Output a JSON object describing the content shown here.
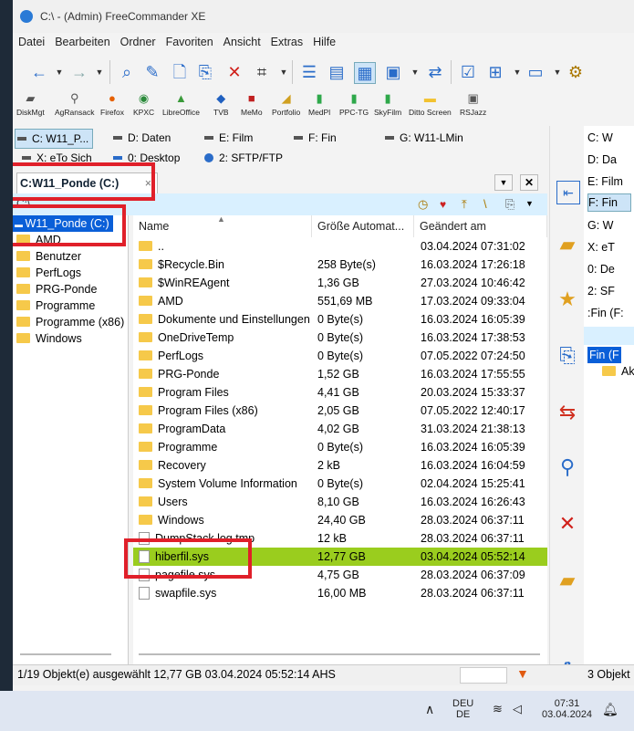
{
  "window": {
    "title": "C:\\ - (Admin) FreeCommander XE"
  },
  "menu": [
    "Datei",
    "Bearbeiten",
    "Ordner",
    "Favoriten",
    "Ansicht",
    "Extras",
    "Hilfe"
  ],
  "toolbar_apps": [
    {
      "label": "DiskMgt",
      "icon": "disk-icon"
    },
    {
      "label": "AgRansack",
      "icon": "search-tool-icon"
    },
    {
      "label": "Firefox",
      "icon": "firefox-icon"
    },
    {
      "label": "KPXC",
      "icon": "keepass-icon"
    },
    {
      "label": "LibreOffice",
      "icon": "libreoffice-icon"
    },
    {
      "label": "TVB",
      "icon": "tvb-icon"
    },
    {
      "label": "MeMo",
      "icon": "memo-icon"
    },
    {
      "label": "Portfolio",
      "icon": "portfolio-icon"
    },
    {
      "label": "MedPl",
      "icon": "medpl-icon"
    },
    {
      "label": "PPC-TG",
      "icon": "ppc-icon"
    },
    {
      "label": "SkyFilm",
      "icon": "skyfilm-icon"
    },
    {
      "label": "Ditto Screen",
      "icon": "folder-icon"
    },
    {
      "label": "RSJazz",
      "icon": "rsjazz-icon"
    }
  ],
  "drives_left": [
    {
      "label": "C: W11_P..."
    },
    {
      "label": "D: Daten"
    },
    {
      "label": "E: Film"
    },
    {
      "label": "F: Fin"
    },
    {
      "label": "G: W11-LMin"
    },
    {
      "label": "X: eTo Sich"
    },
    {
      "label": "0: Desktop"
    },
    {
      "label": "2: SFTP/FTP"
    }
  ],
  "left_tab": {
    "label": "C:W11_Ponde (C:)",
    "close": "×"
  },
  "path": "C:\\",
  "tree": {
    "root": "W11_Ponde (C:)",
    "items": [
      "AMD",
      "Benutzer",
      "PerfLogs",
      "PRG-Ponde",
      "Programme",
      "Programme (x86)",
      "Windows"
    ]
  },
  "columns": {
    "name": "Name",
    "size": "Größe Automat...",
    "date": "Geändert am"
  },
  "files": [
    {
      "name": "..",
      "size": "",
      "date": "03.04.2024 07:31:02",
      "type": "folder"
    },
    {
      "name": "$Recycle.Bin",
      "size": "258 Byte(s)",
      "date": "16.03.2024 17:26:18",
      "type": "folder"
    },
    {
      "name": "$WinREAgent",
      "size": "1,36 GB",
      "date": "27.03.2024 10:46:42",
      "type": "folder"
    },
    {
      "name": "AMD",
      "size": "551,69 MB",
      "date": "17.03.2024 09:33:04",
      "type": "folder"
    },
    {
      "name": "Dokumente und Einstellungen",
      "size": "0 Byte(s)",
      "date": "16.03.2024 16:05:39",
      "type": "folder"
    },
    {
      "name": "OneDriveTemp",
      "size": "0 Byte(s)",
      "date": "16.03.2024 17:38:53",
      "type": "folder"
    },
    {
      "name": "PerfLogs",
      "size": "0 Byte(s)",
      "date": "07.05.2022 07:24:50",
      "type": "folder"
    },
    {
      "name": "PRG-Ponde",
      "size": "1,52 GB",
      "date": "16.03.2024 17:55:55",
      "type": "folder"
    },
    {
      "name": "Program Files",
      "size": "4,41 GB",
      "date": "20.03.2024 15:33:37",
      "type": "folder"
    },
    {
      "name": "Program Files (x86)",
      "size": "2,05 GB",
      "date": "07.05.2022 12:40:17",
      "type": "folder"
    },
    {
      "name": "ProgramData",
      "size": "4,02 GB",
      "date": "31.03.2024 21:38:13",
      "type": "folder"
    },
    {
      "name": "Programme",
      "size": "0 Byte(s)",
      "date": "16.03.2024 16:05:39",
      "type": "folder"
    },
    {
      "name": "Recovery",
      "size": "2 kB",
      "date": "16.03.2024 16:04:59",
      "type": "folder"
    },
    {
      "name": "System Volume Information",
      "size": "0 Byte(s)",
      "date": "02.04.2024 15:25:41",
      "type": "folder"
    },
    {
      "name": "Users",
      "size": "8,10 GB",
      "date": "16.03.2024 16:26:43",
      "type": "folder"
    },
    {
      "name": "Windows",
      "size": "24,40 GB",
      "date": "28.03.2024 06:37:11",
      "type": "folder"
    },
    {
      "name": "DumpStack.log.tmp",
      "size": "12 kB",
      "date": "28.03.2024 06:37:11",
      "type": "file"
    },
    {
      "name": "hiberfil.sys",
      "size": "12,77 GB",
      "date": "03.04.2024 05:52:14",
      "type": "file",
      "selected": true
    },
    {
      "name": "pagefile.sys",
      "size": "4,75 GB",
      "date": "28.03.2024 06:37:09",
      "type": "file"
    },
    {
      "name": "swapfile.sys",
      "size": "16,00 MB",
      "date": "28.03.2024 06:37:11",
      "type": "file"
    }
  ],
  "status": {
    "text": "1/19 Objekt(e) ausgewählt   12,77 GB   03.04.2024 05:52:14   AHS",
    "right": "3 Objekt"
  },
  "right_panel": {
    "drives": [
      "C: W",
      "D: Da",
      "E: Film",
      "F: Fin",
      "G: W",
      "X: eT",
      "0: De",
      "2: SF"
    ],
    "path": ":Fin (F:",
    "tree_root": "Fin (F",
    "tree_item": "Ak"
  },
  "taskbar": {
    "lang_top": "DEU",
    "lang_bottom": "DE",
    "time": "07:31",
    "date": "03.04.2024"
  },
  "colors": {
    "selection": "#9acd1e",
    "path_bg": "#d9f0ff",
    "highlight_box": "#e0202a",
    "tree_root": "#0a5fd8"
  }
}
